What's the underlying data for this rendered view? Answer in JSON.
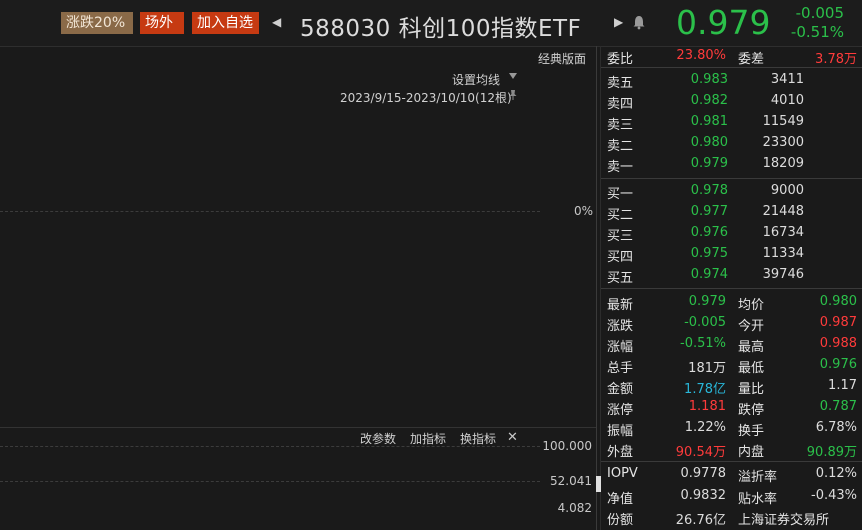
{
  "header": {
    "tag_limit": "涨跌20%",
    "tag_exchange": "场外",
    "tag_favorite": "加入自选",
    "arrow_prev": "◀",
    "arrow_next": "▶",
    "title": "588030 科创100指数ETF",
    "price": "0.979",
    "change": "-0.005",
    "change_pct": "-0.51%",
    "colors": {
      "down": "#2bc04a",
      "up": "#ff3b3b"
    }
  },
  "chart": {
    "classic_layout": "经典版面",
    "set_ma": "设置均线",
    "date_range": "2023/9/15-2023/10/10(12根)",
    "pct_label": "0%",
    "sub_tools": {
      "params": "改参数",
      "add": "加指标",
      "switch": "换指标",
      "close": "✕"
    },
    "sub_axis": [
      "100.000",
      "52.041",
      "4.082"
    ]
  },
  "order_book": {
    "ratio_label": "委比",
    "ratio_value": "23.80%",
    "diff_label": "委差",
    "diff_value": "3.78万",
    "asks": [
      {
        "label": "卖五",
        "price": "0.983",
        "vol": "3411"
      },
      {
        "label": "卖四",
        "price": "0.982",
        "vol": "4010"
      },
      {
        "label": "卖三",
        "price": "0.981",
        "vol": "11549"
      },
      {
        "label": "卖二",
        "price": "0.980",
        "vol": "23300"
      },
      {
        "label": "卖一",
        "price": "0.979",
        "vol": "18209"
      }
    ],
    "bids": [
      {
        "label": "买一",
        "price": "0.978",
        "vol": "9000"
      },
      {
        "label": "买二",
        "price": "0.977",
        "vol": "21448"
      },
      {
        "label": "买三",
        "price": "0.976",
        "vol": "16734"
      },
      {
        "label": "买四",
        "price": "0.975",
        "vol": "11334"
      },
      {
        "label": "买五",
        "price": "0.974",
        "vol": "39746"
      }
    ]
  },
  "stats": [
    {
      "l": "最新",
      "lv": "0.979",
      "r": "均价",
      "rv": "0.980"
    },
    {
      "l": "涨跌",
      "lv": "-0.005",
      "r": "今开",
      "rv": "0.987"
    },
    {
      "l": "涨幅",
      "lv": "-0.51%",
      "r": "最高",
      "rv": "0.988"
    },
    {
      "l": "总手",
      "lv": "181万",
      "r": "最低",
      "rv": "0.976"
    },
    {
      "l": "金额",
      "lv": "1.78亿",
      "r": "量比",
      "rv": "1.17"
    },
    {
      "l": "涨停",
      "lv": "1.181",
      "r": "跌停",
      "rv": "0.787"
    },
    {
      "l": "振幅",
      "lv": "1.22%",
      "r": "换手",
      "rv": "6.78%"
    },
    {
      "l": "外盘",
      "lv": "90.54万",
      "r": "内盘",
      "rv": "90.89万"
    }
  ],
  "fund": [
    {
      "l": "IOPV",
      "lv": "0.9778",
      "r": "溢折率",
      "rv": "0.12%"
    },
    {
      "l": "净值",
      "lv": "0.9832",
      "r": "贴水率",
      "rv": "-0.43%"
    },
    {
      "l": "份额",
      "lv": "26.76亿",
      "r": "上海证券交易所",
      "rv": ""
    }
  ]
}
